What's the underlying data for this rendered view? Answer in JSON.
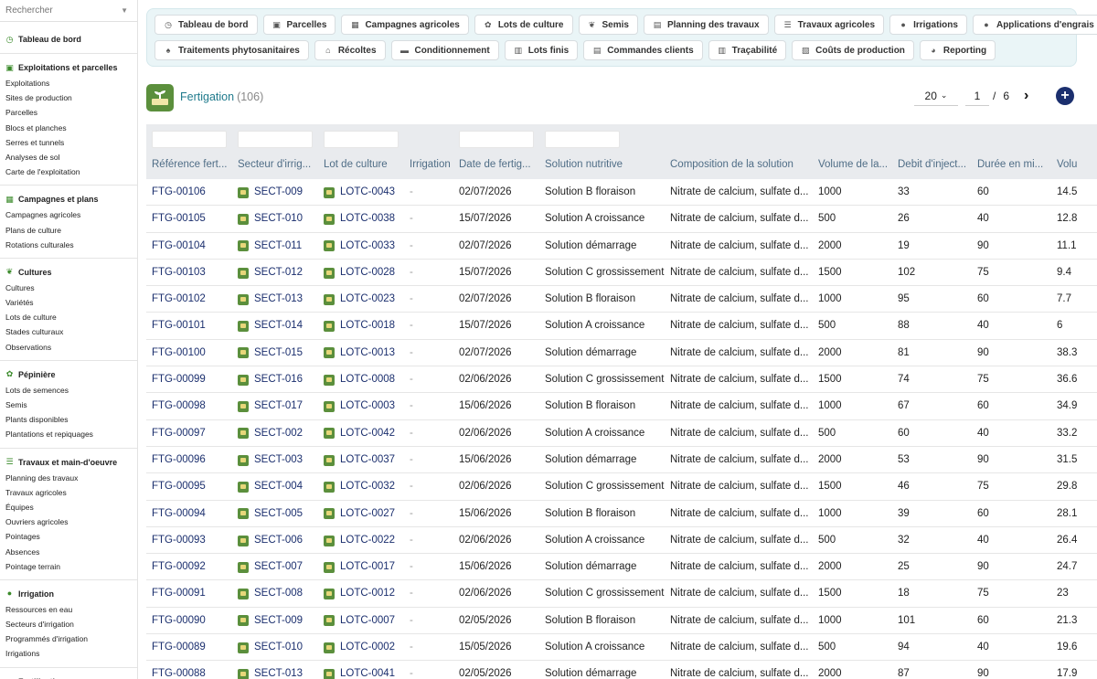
{
  "sidebar": {
    "search_placeholder": "Rechercher",
    "top_item": {
      "label": "Tableau de bord",
      "icon": "dashboard-icon"
    },
    "sections": [
      {
        "title": "Exploitations et parcelles",
        "icon": "parcel-icon",
        "items": [
          "Exploitations",
          "Sites de production",
          "Parcelles",
          "Blocs et planches",
          "Serres et tunnels",
          "Analyses de sol",
          "Carte de l'exploitation"
        ]
      },
      {
        "title": "Campagnes et plans",
        "icon": "calendar-icon",
        "items": [
          "Campagnes agricoles",
          "Plans de culture",
          "Rotations culturales"
        ]
      },
      {
        "title": "Cultures",
        "icon": "leaf-icon",
        "items": [
          "Cultures",
          "Variétés",
          "Lots de culture",
          "Stades culturaux",
          "Observations"
        ]
      },
      {
        "title": "Pépinière",
        "icon": "seedling-icon",
        "items": [
          "Lots de semences",
          "Semis",
          "Plants disponibles",
          "Plantations et repiquages"
        ]
      },
      {
        "title": "Travaux et main-d'oeuvre",
        "icon": "tasks-icon",
        "items": [
          "Planning des travaux",
          "Travaux agricoles",
          "Équipes",
          "Ouvriers agricoles",
          "Pointages",
          "Absences",
          "Pointage terrain"
        ]
      },
      {
        "title": "Irrigation",
        "icon": "water-drop-icon",
        "items": [
          "Ressources en eau",
          "Secteurs d'irrigation",
          "Programmés d'irrigation",
          "Irrigations"
        ]
      },
      {
        "title": "Fertilisation",
        "icon": "fertilizer-icon",
        "items": []
      }
    ]
  },
  "tabs": {
    "row1": [
      {
        "label": "Tableau de bord",
        "icon": "dashboard-icon"
      },
      {
        "label": "Parcelles",
        "icon": "parcel-icon"
      },
      {
        "label": "Campagnes agricoles",
        "icon": "calendar-icon"
      },
      {
        "label": "Lots de culture",
        "icon": "seedling-icon"
      },
      {
        "label": "Semis",
        "icon": "leaf-icon"
      },
      {
        "label": "Planning des travaux",
        "icon": "calendar-check-icon"
      },
      {
        "label": "Travaux agricoles",
        "icon": "tasks-icon"
      },
      {
        "label": "Irrigations",
        "icon": "water-drop-icon"
      },
      {
        "label": "Applications d'engrais",
        "icon": "fertilizer-icon"
      }
    ],
    "row2": [
      {
        "label": "Traitements phytosanitaires",
        "icon": "spray-icon"
      },
      {
        "label": "Récoltes",
        "icon": "basket-icon"
      },
      {
        "label": "Conditionnement",
        "icon": "box-icon"
      },
      {
        "label": "Lots finis",
        "icon": "pallet-icon"
      },
      {
        "label": "Commandes clients",
        "icon": "order-icon"
      },
      {
        "label": "Traçabilité",
        "icon": "barcode-icon"
      },
      {
        "label": "Coûts de production",
        "icon": "money-icon"
      },
      {
        "label": "Reporting",
        "icon": "pie-chart-icon"
      }
    ]
  },
  "header": {
    "title": "Fertigation",
    "count": "(106)"
  },
  "pager": {
    "page_size": "20",
    "page": "1",
    "separator": "/",
    "total_pages": "6"
  },
  "table": {
    "columns": [
      "Référence fert...",
      "Secteur d'irrig...",
      "Lot de culture",
      "Irrigation",
      "Date de fertig...",
      "Solution nutritive",
      "Composition de la solution",
      "Volume de la...",
      "Debit d'inject...",
      "Durée en mi...",
      "Volu"
    ],
    "rows": [
      [
        "FTG-00106",
        "SECT-009",
        "LOTC-0043",
        "-",
        "02/07/2026",
        "Solution B floraison",
        "Nitrate de calcium, sulfate d...",
        "1000",
        "33",
        "60",
        "14.5"
      ],
      [
        "FTG-00105",
        "SECT-010",
        "LOTC-0038",
        "-",
        "15/07/2026",
        "Solution A croissance",
        "Nitrate de calcium, sulfate d...",
        "500",
        "26",
        "40",
        "12.8"
      ],
      [
        "FTG-00104",
        "SECT-011",
        "LOTC-0033",
        "-",
        "02/07/2026",
        "Solution démarrage",
        "Nitrate de calcium, sulfate d...",
        "2000",
        "19",
        "90",
        "11.1"
      ],
      [
        "FTG-00103",
        "SECT-012",
        "LOTC-0028",
        "-",
        "15/07/2026",
        "Solution C grossissement",
        "Nitrate de calcium, sulfate d...",
        "1500",
        "102",
        "75",
        "9.4"
      ],
      [
        "FTG-00102",
        "SECT-013",
        "LOTC-0023",
        "-",
        "02/07/2026",
        "Solution B floraison",
        "Nitrate de calcium, sulfate d...",
        "1000",
        "95",
        "60",
        "7.7"
      ],
      [
        "FTG-00101",
        "SECT-014",
        "LOTC-0018",
        "-",
        "15/07/2026",
        "Solution A croissance",
        "Nitrate de calcium, sulfate d...",
        "500",
        "88",
        "40",
        "6"
      ],
      [
        "FTG-00100",
        "SECT-015",
        "LOTC-0013",
        "-",
        "02/07/2026",
        "Solution démarrage",
        "Nitrate de calcium, sulfate d...",
        "2000",
        "81",
        "90",
        "38.3"
      ],
      [
        "FTG-00099",
        "SECT-016",
        "LOTC-0008",
        "-",
        "02/06/2026",
        "Solution C grossissement",
        "Nitrate de calcium, sulfate d...",
        "1500",
        "74",
        "75",
        "36.6"
      ],
      [
        "FTG-00098",
        "SECT-017",
        "LOTC-0003",
        "-",
        "15/06/2026",
        "Solution B floraison",
        "Nitrate de calcium, sulfate d...",
        "1000",
        "67",
        "60",
        "34.9"
      ],
      [
        "FTG-00097",
        "SECT-002",
        "LOTC-0042",
        "-",
        "02/06/2026",
        "Solution A croissance",
        "Nitrate de calcium, sulfate d...",
        "500",
        "60",
        "40",
        "33.2"
      ],
      [
        "FTG-00096",
        "SECT-003",
        "LOTC-0037",
        "-",
        "15/06/2026",
        "Solution démarrage",
        "Nitrate de calcium, sulfate d...",
        "2000",
        "53",
        "90",
        "31.5"
      ],
      [
        "FTG-00095",
        "SECT-004",
        "LOTC-0032",
        "-",
        "02/06/2026",
        "Solution C grossissement",
        "Nitrate de calcium, sulfate d...",
        "1500",
        "46",
        "75",
        "29.8"
      ],
      [
        "FTG-00094",
        "SECT-005",
        "LOTC-0027",
        "-",
        "15/06/2026",
        "Solution B floraison",
        "Nitrate de calcium, sulfate d...",
        "1000",
        "39",
        "60",
        "28.1"
      ],
      [
        "FTG-00093",
        "SECT-006",
        "LOTC-0022",
        "-",
        "02/06/2026",
        "Solution A croissance",
        "Nitrate de calcium, sulfate d...",
        "500",
        "32",
        "40",
        "26.4"
      ],
      [
        "FTG-00092",
        "SECT-007",
        "LOTC-0017",
        "-",
        "15/06/2026",
        "Solution démarrage",
        "Nitrate de calcium, sulfate d...",
        "2000",
        "25",
        "90",
        "24.7"
      ],
      [
        "FTG-00091",
        "SECT-008",
        "LOTC-0012",
        "-",
        "02/06/2026",
        "Solution C grossissement",
        "Nitrate de calcium, sulfate d...",
        "1500",
        "18",
        "75",
        "23"
      ],
      [
        "FTG-00090",
        "SECT-009",
        "LOTC-0007",
        "-",
        "02/05/2026",
        "Solution B floraison",
        "Nitrate de calcium, sulfate d...",
        "1000",
        "101",
        "60",
        "21.3"
      ],
      [
        "FTG-00089",
        "SECT-010",
        "LOTC-0002",
        "-",
        "15/05/2026",
        "Solution A croissance",
        "Nitrate de calcium, sulfate d...",
        "500",
        "94",
        "40",
        "19.6"
      ],
      [
        "FTG-00088",
        "SECT-013",
        "LOTC-0041",
        "-",
        "02/05/2026",
        "Solution démarrage",
        "Nitrate de calcium, sulfate d...",
        "2000",
        "87",
        "90",
        "17.9"
      ]
    ]
  },
  "colors": {
    "accent": "#1f7a8c",
    "link": "#1b2f6e",
    "brand_green": "#5b8f3c",
    "tab_bg": "#eaf5f7",
    "header_bg": "#e9ebee"
  }
}
